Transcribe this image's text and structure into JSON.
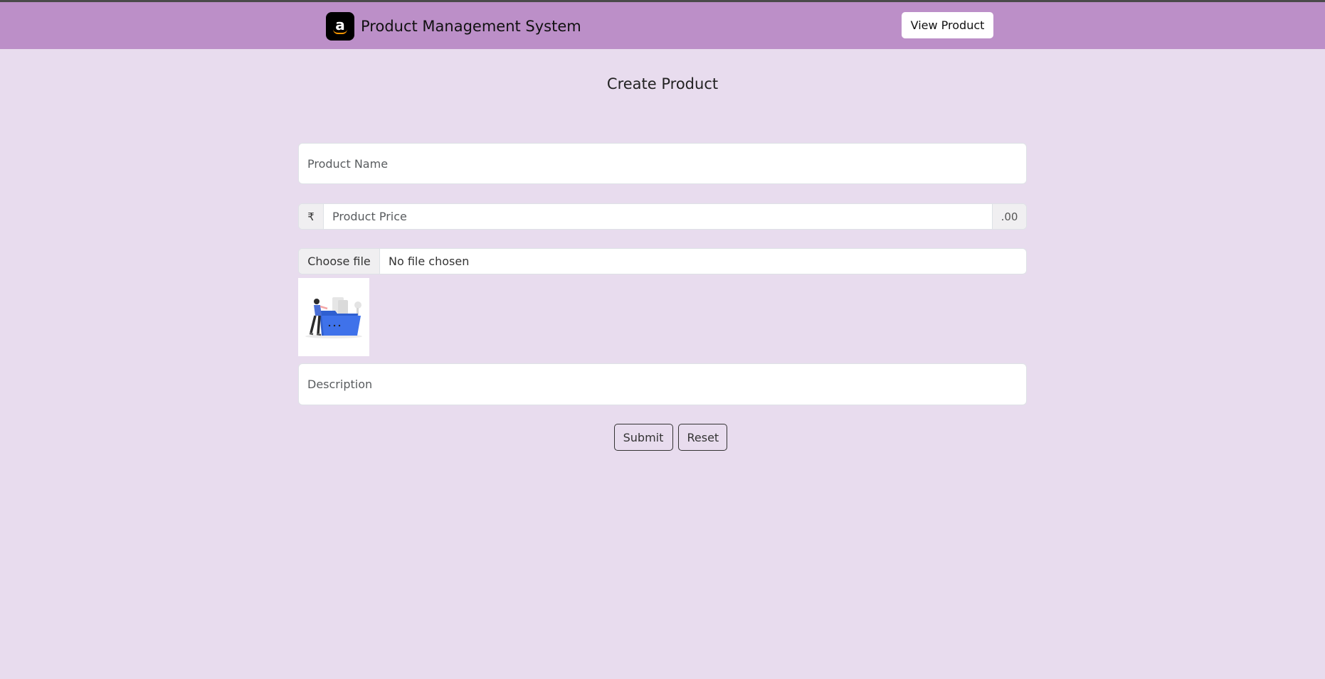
{
  "navbar": {
    "brand_title": "Product Management System",
    "brand_logo_letter": "a",
    "view_button_label": "View Product",
    "background_color": "#bc8fc8"
  },
  "page": {
    "heading": "Create Product",
    "background_color": "#e8dcee"
  },
  "form": {
    "name_placeholder": "Product Name",
    "price": {
      "currency_symbol": "₹",
      "placeholder": "Product Price",
      "suffix": ".00"
    },
    "file": {
      "button_label": "Choose file",
      "status": "No file chosen"
    },
    "preview_image_icon": "folder-illustration-icon",
    "description_placeholder": "Description",
    "submit_label": "Submit",
    "reset_label": "Reset"
  }
}
